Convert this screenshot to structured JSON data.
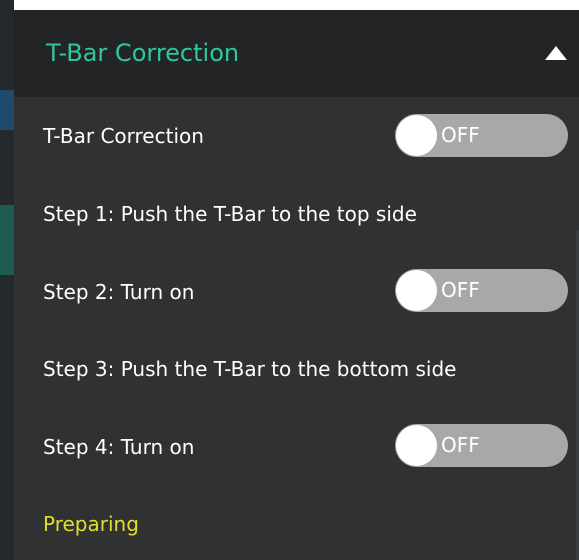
{
  "panel": {
    "title": "T-Bar Correction",
    "collapse_icon": "triangle-up-icon",
    "colors": {
      "title": "#2ec7a0",
      "status": "#e3de2a",
      "header_bg": "#222426",
      "body_bg": "#2f3133",
      "toggle_bg": "#a8a8a8"
    }
  },
  "rows": {
    "tbar_correction": {
      "label": "T-Bar Correction",
      "toggle": "OFF"
    },
    "step1": {
      "label": "Step 1: Push the T-Bar to the top side"
    },
    "step2": {
      "label": "Step 2: Turn on",
      "toggle": "OFF"
    },
    "step3": {
      "label": "Step 3: Push the T-Bar to the bottom side"
    },
    "step4": {
      "label": "Step 4: Turn on",
      "toggle": "OFF"
    }
  },
  "status": "Preparing"
}
